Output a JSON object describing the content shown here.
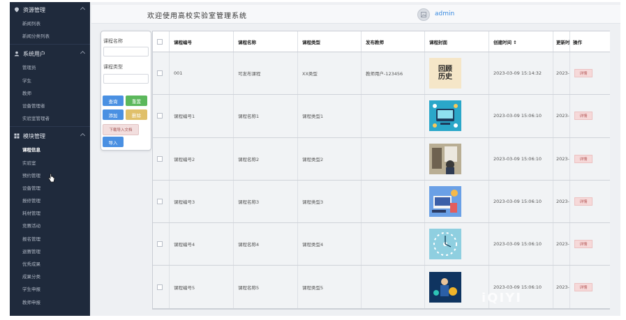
{
  "header": {
    "welcome": "欢迎使用高校实验室管理系统",
    "username": "admin"
  },
  "sidebar": {
    "sections": [
      {
        "title": "资源管理",
        "icon": "location-icon",
        "items": [
          "新闻列表",
          "新闻分类列表"
        ]
      },
      {
        "title": "系统用户",
        "icon": "user-icon",
        "items": [
          "管理员",
          "学生",
          "教师",
          "设备管理者",
          "实验室管理者"
        ]
      },
      {
        "title": "模块管理",
        "icon": "grid-icon",
        "items": [
          "课程信息",
          "实验室",
          "预约管理",
          "设备管理",
          "报修管理",
          "耗材管理",
          "竞赛活动",
          "报名管理",
          "退赛管理",
          "优秀成果",
          "成果分类",
          "学生申报",
          "教师申报"
        ]
      }
    ],
    "active_item": "课程信息"
  },
  "search": {
    "label_name": "课程名称",
    "label_type": "课程类型",
    "query_btn": "查询",
    "reset_btn": "重置",
    "add_btn": "添加",
    "delete_btn": "删除",
    "download_btn": "下载导入文档",
    "import_btn": "导入"
  },
  "table": {
    "columns": [
      "课程编号",
      "课程名称",
      "课程类型",
      "发布教师",
      "课程封面",
      "创建时间 ↕",
      "更新时间",
      "操作"
    ],
    "rows": [
      {
        "id": "001",
        "name": "可发布课程",
        "type": "XX类型",
        "teacher": "教师用户-123456",
        "cover_text": "回顾\n历史",
        "created": "2023-03-09 15:14:32",
        "updated": "2023-0",
        "action": "详情"
      },
      {
        "id": "课程编号1",
        "name": "课程名称1",
        "type": "课程类型1",
        "teacher": "",
        "cover_text": "",
        "created": "2023-03-09 15:06:10",
        "updated": "2023-0",
        "action": "详情"
      },
      {
        "id": "课程编号2",
        "name": "课程名称2",
        "type": "课程类型2",
        "teacher": "",
        "cover_text": "",
        "created": "2023-03-09 15:06:10",
        "updated": "2023-0",
        "action": "详情"
      },
      {
        "id": "课程编号3",
        "name": "课程名称3",
        "type": "课程类型3",
        "teacher": "",
        "cover_text": "",
        "created": "2023-03-09 15:06:10",
        "updated": "2023-0",
        "action": "详情"
      },
      {
        "id": "课程编号4",
        "name": "课程名称4",
        "type": "课程类型4",
        "teacher": "",
        "cover_text": "",
        "created": "2023-03-09 15:06:10",
        "updated": "2023-0",
        "action": "详情"
      },
      {
        "id": "课程编号5",
        "name": "课程名称5",
        "type": "课程类型5",
        "teacher": "",
        "cover_text": "",
        "created": "2023-03-09 15:06:10",
        "updated": "2023-0",
        "action": "详情"
      }
    ]
  },
  "watermark": "iQIYI",
  "colors": {
    "sidebar_bg": "#1f2a3c",
    "query": "#4a90e2",
    "reset": "#5cb85c",
    "add": "#4a90e2",
    "delete": "#e0c06a",
    "detail": "#f6d9d9"
  }
}
